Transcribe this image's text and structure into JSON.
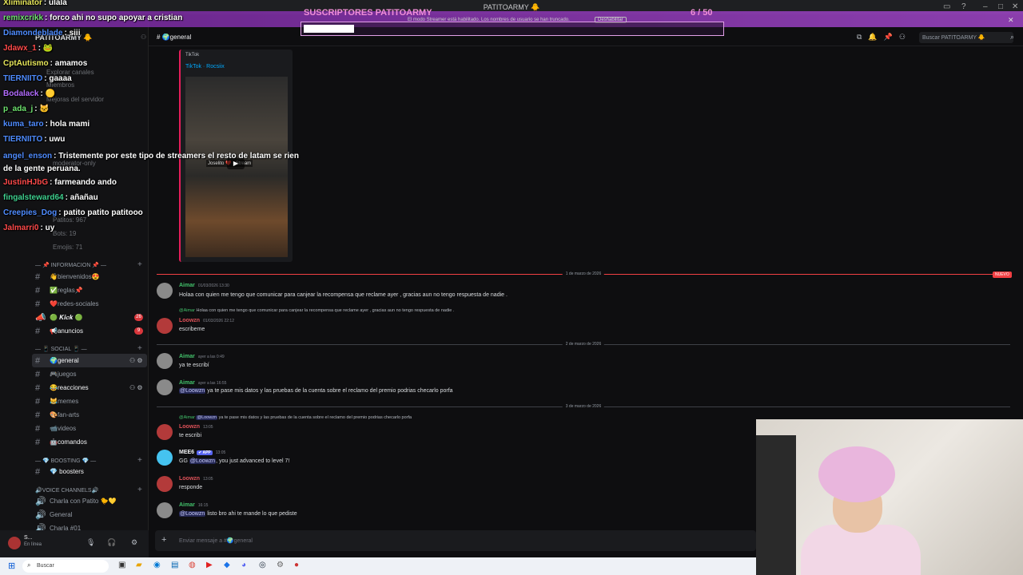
{
  "window": {
    "title": "PATITOARMY 🐥"
  },
  "sidebar": {
    "server_name": "PATITOARMY 🐥",
    "dim_items": [
      "Explorar canales",
      "Miembros",
      "Mejoras del servidor",
      "moderator-only",
      "Patitos: 967",
      "Bots: 19",
      "Emojis: 71"
    ],
    "categories": [
      {
        "label": "— 📌 INFORMACION 📌 —"
      },
      {
        "label": "— 📱 SOCIAL 📱 —"
      },
      {
        "label": "— 💎 BOOSTING 💎 —"
      },
      {
        "label": "🔊Voice Channels🔊"
      }
    ],
    "channels": [
      {
        "label": "👋bienvenidos😍",
        "badge": ""
      },
      {
        "label": "✅reglas📌",
        "badge": ""
      },
      {
        "label": "❤️redes-sociales",
        "badge": ""
      },
      {
        "label": "🟢 𝑲𝒊𝒄𝒌 🟢",
        "badge": "26"
      },
      {
        "label": "📢anuncios",
        "badge": "9"
      },
      {
        "label": "🌍general",
        "badge": ""
      },
      {
        "label": "🎮juegos",
        "badge": ""
      },
      {
        "label": "😂reacciones",
        "badge": ""
      },
      {
        "label": "😹memes",
        "badge": ""
      },
      {
        "label": "🎨fan-arts",
        "badge": ""
      },
      {
        "label": "📹videos",
        "badge": ""
      },
      {
        "label": "🤖comandos",
        "badge": ""
      },
      {
        "label": "💎 boosters",
        "badge": ""
      },
      {
        "label": "Charla con Patito 🐤💛",
        "badge": ""
      },
      {
        "label": "General",
        "badge": ""
      },
      {
        "label": "Charla #01",
        "badge": ""
      }
    ],
    "user": {
      "name": "S...",
      "status": "En línea"
    }
  },
  "header": {
    "channel": "🌍general",
    "search_placeholder": "Buscar PATITOARMY 🐥"
  },
  "embed": {
    "provider": "TikTok",
    "title": "TikTok · Rocsiix",
    "video_label": "Joselito ❤️ · Stream"
  },
  "dividers": [
    {
      "label": "1 de marzo de 2026",
      "badge": "NUEVO"
    },
    {
      "label": "2 de marzo de 2026"
    },
    {
      "label": "3 de marzo de 2026"
    }
  ],
  "messages": [
    {
      "author": "Aimar",
      "time": "01/03/2026 13:30",
      "text": "Holaa con quien me tengo que comunicar para canjear la recompensa que reclame ayer , gracias aun no tengo respuesta de nadie ."
    },
    {
      "reply_to": "@Aimar",
      "reply_text": "Holaa con quien me tengo que comunicar para canjear la recompensa que reclame ayer , gracias aun no tengo respuesta de nadie .",
      "author": "Loowzn",
      "time": "01/03/2026 22:12",
      "text": "escribeme"
    },
    {
      "author": "Aimar",
      "time": "ayer a las 0:49",
      "text": "ya te escribí"
    },
    {
      "author": "Aimar",
      "time": "ayer a las 16:55",
      "mention": "@Loowzn",
      "text": "ya te pase mis datos y las pruebas de la cuenta sobre el reclamo del premio podrias checarlo porfa"
    },
    {
      "reply_to": "@Aimar",
      "reply_mention": "@Loowzn",
      "reply_text": "ya te pase mis datos y las pruebas de la cuenta sobre el reclamo del premio podrias checarlo porfa",
      "author": "Loowzn",
      "time": "13:05",
      "text": "te escribi"
    },
    {
      "author": "MEE6",
      "tag": "✔ APP",
      "time": "13:05",
      "prefix": "GG",
      "mention": "@Loowzn",
      "text": ", you just advanced to level 7!"
    },
    {
      "author": "Loowzn",
      "time": "13:05",
      "text": "responde"
    },
    {
      "author": "Aimar",
      "time": "16:15",
      "mention": "@Loowzn",
      "text": "listo bro ahi te mande lo que pediste"
    }
  ],
  "composer": {
    "placeholder": "Enviar mensaje a #🌍general"
  },
  "overlay": {
    "title": "SUSCRIPTORES PATITOARMY",
    "count": "6 / 50",
    "progress": 0.12,
    "notice": "El modo Streamer está habilitado. Los nombres de usuario se han truncado.",
    "notice_button": "Deshabilitar"
  },
  "stream_chat": [
    {
      "user": "Xliminator",
      "text": ": ulala",
      "color": "#e5e55a"
    },
    {
      "user": "remixcrikk",
      "text": ": forco ahi no supo apoyar a cristian",
      "color": "#6ee36e"
    },
    {
      "user": "Diamondeblade",
      "text": ": siii",
      "color": "#4f8cff"
    },
    {
      "user": "Jdawx_1",
      "text": ": 🐸",
      "color": "#ff4a4a"
    },
    {
      "user": "CptAutismo",
      "text": ": amamos",
      "color": "#e5e55a"
    },
    {
      "user": "TIERNIITO",
      "text": ": gaaaa",
      "color": "#4f8cff"
    },
    {
      "user": "Bodalack",
      "text": ": 🟡",
      "color": "#b36cff"
    },
    {
      "user": "p_ada_j",
      "text": ": 🐱",
      "color": "#6ee36e"
    },
    {
      "user": "kuma_taro",
      "text": ": hola mami",
      "color": "#4f8cff"
    },
    {
      "user": "TIERNIITO",
      "text": ": uwu",
      "color": "#4f8cff"
    },
    {
      "user": "angel_enson",
      "text": ": Tristemente por este tipo de streamers el resto de latam se rien de la gente peruana.",
      "color": "#4f8cff"
    },
    {
      "user": "JustinHJbG",
      "text": ": farmeando ando",
      "color": "#ff4a4a"
    },
    {
      "user": "fingalsteward64",
      "text": ": añañau",
      "color": "#3fd08f"
    },
    {
      "user": "Creepies_Dog",
      "text": ": patito patito patitooo",
      "color": "#4f8cff"
    },
    {
      "user": "Jalmarri0",
      "text": ": uy",
      "color": "#ff4a4a"
    }
  ],
  "taskbar": {
    "search": "Buscar"
  }
}
